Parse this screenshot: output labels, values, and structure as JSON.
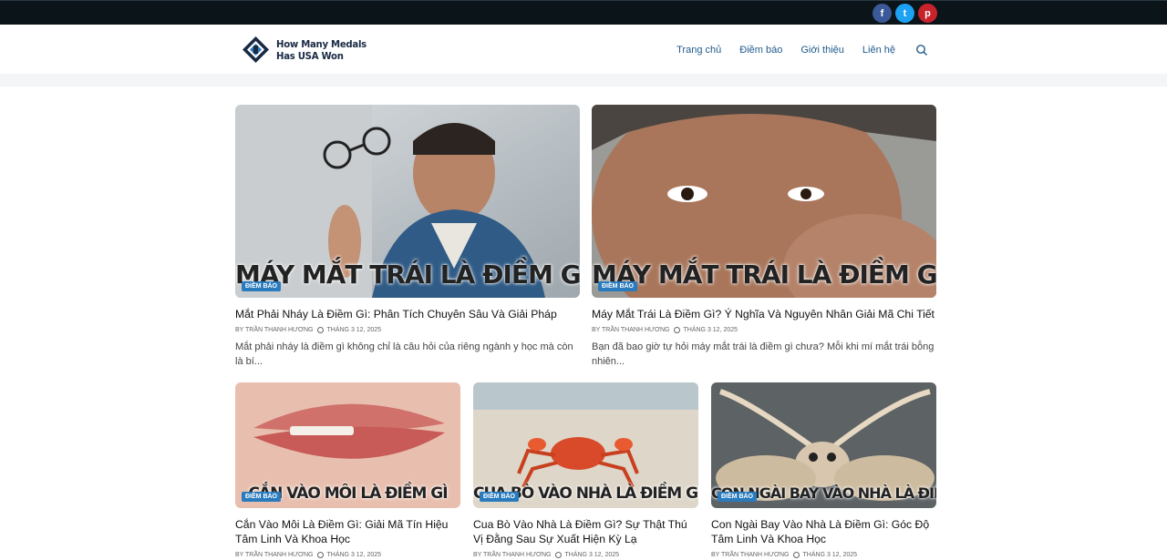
{
  "site": {
    "logo_line1": "How Many Medals",
    "logo_line2": "Has USA Won"
  },
  "social": [
    "f",
    "t",
    "p"
  ],
  "nav": {
    "items": [
      "Trang chủ",
      "Điềm báo",
      "Giới thiệu",
      "Liên hệ"
    ]
  },
  "posts": [
    {
      "title": "Mắt Phải Nháy Là Điềm Gì: Phân Tích Chuyên Sâu Và Giải Pháp",
      "badge": "ĐIỀM BÁO",
      "overlay": "MÁY MẮT TRÁI LÀ ĐIỀM GÌ",
      "author": "BY TRẦN THANH HƯƠNG",
      "date": "THÁNG 3 12, 2025",
      "excerpt": "Mắt phải nháy là điềm gì không chỉ là câu hỏi của riêng ngành y học mà còn là bí..."
    },
    {
      "title": "Máy Mắt Trái Là Điềm Gì? Ý Nghĩa Và Nguyên Nhân Giải Mã Chi Tiết",
      "badge": "ĐIỀM BÁO",
      "overlay": "MÁY MẮT TRÁI LÀ ĐIỀM GÌ",
      "author": "BY TRẦN THANH HƯƠNG",
      "date": "THÁNG 3 12, 2025",
      "excerpt": "Bạn đã bao giờ tự hỏi máy mắt trái là điềm gì chưa? Mỗi khi mí mắt trái bỗng nhiên..."
    },
    {
      "title": "Cắn Vào Môi Là Điềm Gì: Giải Mã Tín Hiệu Tâm Linh Và Khoa Học",
      "badge": "ĐIỀM BÁO",
      "overlay": "CẮN VÀO MÔI LÀ ĐIỀM GÌ",
      "author": "BY TRẦN THANH HƯƠNG",
      "date": "THÁNG 3 12, 2025"
    },
    {
      "title": "Cua Bò Vào Nhà Là Điềm Gì? Sự Thật Thú Vị Đằng Sau Sự Xuất Hiện Kỳ Lạ",
      "badge": "ĐIỀM BÁO",
      "overlay": "CUA BÒ VÀO NHÀ LÀ ĐIỀM GÌ",
      "author": "BY TRẦN THANH HƯƠNG",
      "date": "THÁNG 3 12, 2025"
    },
    {
      "title": "Con Ngài Bay Vào Nhà Là Điềm Gì: Góc Độ Tâm Linh Và Khoa Học",
      "badge": "ĐIỀM BÁO",
      "overlay": "CON NGÀI BAY VÀO NHÀ LÀ ĐIỀM GÌ",
      "author": "BY TRẦN THANH HƯƠNG",
      "date": "THÁNG 3 12, 2025"
    }
  ],
  "colors": {
    "topbar": "#0b1419",
    "nav_link": "#1e5a8c",
    "badge": "#2a7bbd"
  }
}
